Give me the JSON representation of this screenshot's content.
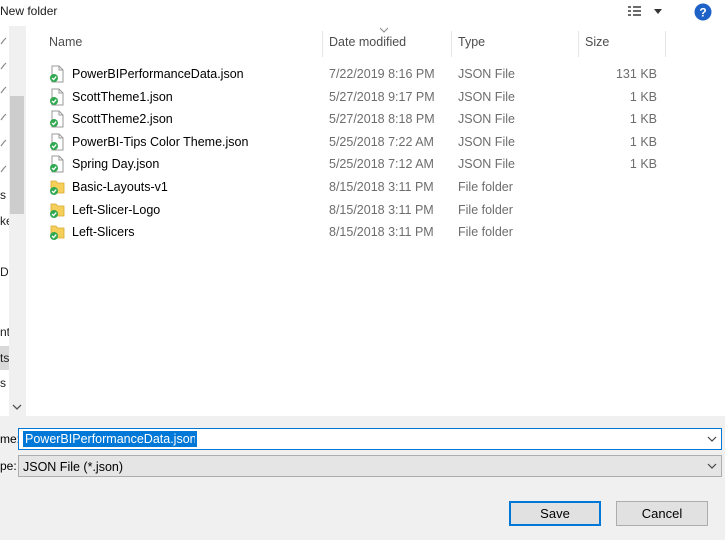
{
  "toolbar": {
    "new_folder_label": "New folder",
    "view_icon": "details-view-icon",
    "help_icon": "help-icon",
    "help_glyph": "?"
  },
  "nav_fragments": [
    "s",
    "ke",
    "De",
    "nt",
    "ts",
    "s"
  ],
  "columns": {
    "name": "Name",
    "date_modified": "Date modified",
    "type": "Type",
    "size": "Size"
  },
  "files": [
    {
      "name": "PowerBIPerformanceData.json",
      "date": "7/22/2019 8:16 PM",
      "type": "JSON File",
      "size": "131 KB",
      "kind": "file"
    },
    {
      "name": "ScottTheme1.json",
      "date": "5/27/2018 9:17 PM",
      "type": "JSON File",
      "size": "1 KB",
      "kind": "file"
    },
    {
      "name": "ScottTheme2.json",
      "date": "5/27/2018 8:18 PM",
      "type": "JSON File",
      "size": "1 KB",
      "kind": "file"
    },
    {
      "name": "PowerBI-Tips Color Theme.json",
      "date": "5/25/2018 7:22 AM",
      "type": "JSON File",
      "size": "1 KB",
      "kind": "file"
    },
    {
      "name": "Spring Day.json",
      "date": "5/25/2018 7:12 AM",
      "type": "JSON File",
      "size": "1 KB",
      "kind": "file"
    },
    {
      "name": "Basic-Layouts-v1",
      "date": "8/15/2018 3:11 PM",
      "type": "File folder",
      "size": "",
      "kind": "folder"
    },
    {
      "name": "Left-Slicer-Logo",
      "date": "8/15/2018 3:11 PM",
      "type": "File folder",
      "size": "",
      "kind": "folder"
    },
    {
      "name": "Left-Slicers",
      "date": "8/15/2018 3:11 PM",
      "type": "File folder",
      "size": "",
      "kind": "folder"
    }
  ],
  "save_form": {
    "filename_label_fragment": "me:",
    "filename_value": "PowerBIPerformanceData.json",
    "type_label_fragment": "pe:",
    "type_value": "JSON File  (*.json)"
  },
  "buttons": {
    "save": "Save",
    "cancel": "Cancel"
  },
  "colors": {
    "accent": "#0078d7",
    "sync_check": "#2fa84f",
    "folder": "#f5cf5a"
  }
}
